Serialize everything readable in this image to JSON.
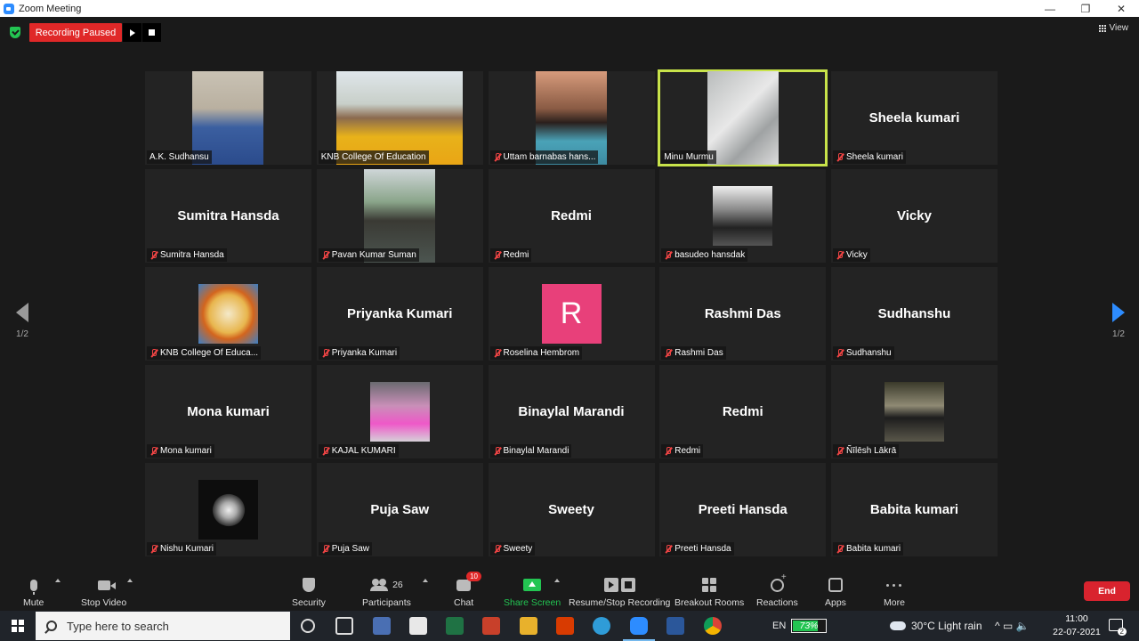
{
  "window": {
    "title": "Zoom Meeting",
    "controls": [
      "—",
      "❐",
      "✕"
    ]
  },
  "recording": {
    "status": "Recording Paused"
  },
  "view_label": "View",
  "pager": {
    "label": "1/2"
  },
  "participants": [
    {
      "name": "A.K. Sudhansu",
      "display": "",
      "kind": "video-1"
    },
    {
      "name": "KNB College Of Education",
      "display": "",
      "kind": "video-2"
    },
    {
      "name": "Uttam barnabas hans...",
      "display": "",
      "kind": "video-3",
      "muted": true
    },
    {
      "name": "Minu Murmu",
      "display": "",
      "kind": "video-4",
      "active": true
    },
    {
      "name": "Sheela kumari",
      "display": "Sheela kumari",
      "muted": true
    },
    {
      "name": "Sumitra Hansda",
      "display": "Sumitra Hansda",
      "muted": true
    },
    {
      "name": "Pavan Kumar Suman",
      "display": "",
      "kind": "video-5",
      "muted": true
    },
    {
      "name": "Redmi",
      "display": "Redmi",
      "muted": true
    },
    {
      "name": "basudeo hansdak",
      "display": "",
      "kind": "av-basudeo",
      "muted": true
    },
    {
      "name": "Vicky",
      "display": "Vicky",
      "muted": true
    },
    {
      "name": "KNB College Of Educa...",
      "display": "",
      "kind": "av-knb",
      "muted": true
    },
    {
      "name": "Priyanka Kumari",
      "display": "Priyanka Kumari",
      "muted": true
    },
    {
      "name": "Roselina Hembrom",
      "display": "",
      "kind": "av-r",
      "initial": "R",
      "muted": true
    },
    {
      "name": "Rashmi Das",
      "display": "Rashmi Das",
      "muted": true
    },
    {
      "name": "Sudhanshu",
      "display": "Sudhanshu",
      "muted": true
    },
    {
      "name": "Mona kumari",
      "display": "Mona kumari",
      "muted": true
    },
    {
      "name": "KAJAL KUMARI",
      "display": "",
      "kind": "av-kajal",
      "muted": true
    },
    {
      "name": "Binaylal Marandi",
      "display": "Binaylal Marandi",
      "muted": true
    },
    {
      "name": "Redmi",
      "display": "Redmi",
      "muted": true
    },
    {
      "name": "Ñīlēsh Lākrā",
      "display": "",
      "kind": "av-nilesh",
      "muted": true
    },
    {
      "name": "Nishu Kumari",
      "display": "",
      "kind": "av-nishu",
      "muted": true
    },
    {
      "name": "Puja Saw",
      "display": "Puja Saw",
      "muted": true
    },
    {
      "name": "Sweety",
      "display": "Sweety",
      "muted": true
    },
    {
      "name": "Preeti Hansda",
      "display": "Preeti Hansda",
      "muted": true
    },
    {
      "name": "Babita kumari",
      "display": "Babita kumari",
      "muted": true
    }
  ],
  "toolbar": {
    "mute": "Mute",
    "stop_video": "Stop Video",
    "security": "Security",
    "participants": "Participants",
    "participants_count": "26",
    "chat": "Chat",
    "chat_badge": "10",
    "share_screen": "Share Screen",
    "record": "Resume/Stop Recording",
    "breakout": "Breakout Rooms",
    "reactions": "Reactions",
    "apps": "Apps",
    "more": "More",
    "end": "End"
  },
  "taskbar": {
    "search_placeholder": "Type here to search",
    "language": "EN",
    "battery": "73%",
    "battery_level": 0.73,
    "weather": "30°C  Light rain",
    "time": "11:00",
    "date": "22-07-2021",
    "notifications": "2",
    "tray_icons": "^  ▭  🔈"
  },
  "colors": {
    "recording_red": "#e02828",
    "active_speaker": "#c8e34a",
    "share_green": "#23c552",
    "end_red": "#d9232e",
    "accent_blue": "#2d8cff"
  }
}
